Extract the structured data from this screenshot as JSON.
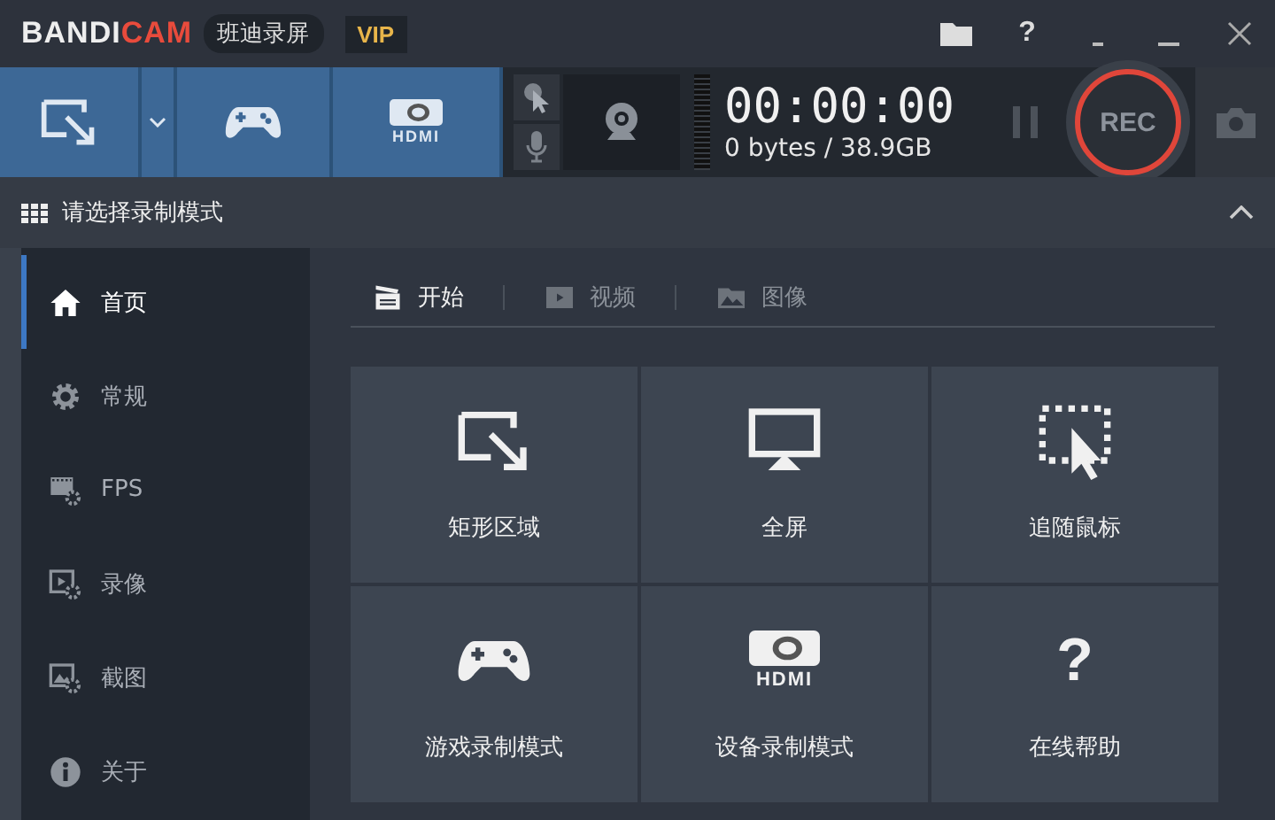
{
  "title_bar": {
    "logo": {
      "part_1": "BANDI",
      "part_2": "CAM"
    },
    "product_name": "班迪录屏",
    "badge": "VIP",
    "help": "?"
  },
  "toolbar": {
    "modes": [
      {
        "kind": "rectangle"
      },
      {
        "kind": "game"
      },
      {
        "kind": "device",
        "label": "HDMI"
      }
    ],
    "timer": "00:00:00",
    "size": "0 bytes / 38.9GB",
    "rec": "REC"
  },
  "mode_bar": {
    "title": "请选择录制模式"
  },
  "sidebar": {
    "items": [
      {
        "kind": "home",
        "label": "首页",
        "selected": true
      },
      {
        "kind": "gear",
        "label": "常规",
        "selected": false
      },
      {
        "kind": "fps",
        "label": "FPS",
        "selected": false
      },
      {
        "kind": "video",
        "label": "录像",
        "selected": false
      },
      {
        "kind": "image",
        "label": "截图",
        "selected": false
      },
      {
        "kind": "info",
        "label": "关于",
        "selected": false
      }
    ]
  },
  "tabs": [
    {
      "kind": "start",
      "label": "开始",
      "selected": true
    },
    {
      "kind": "video",
      "label": "视频",
      "selected": false
    },
    {
      "kind": "image",
      "label": "图像",
      "selected": false
    }
  ],
  "tiles": [
    {
      "kind": "rectangle",
      "label": "矩形区域"
    },
    {
      "kind": "fullscreen",
      "label": "全屏"
    },
    {
      "kind": "follow",
      "label": "追随鼠标"
    },
    {
      "kind": "game",
      "label": "游戏录制模式"
    },
    {
      "kind": "device",
      "label": "设备录制模式",
      "icon_text": "HDMI"
    },
    {
      "kind": "help",
      "label": "在线帮助",
      "icon_text": "?"
    }
  ]
}
